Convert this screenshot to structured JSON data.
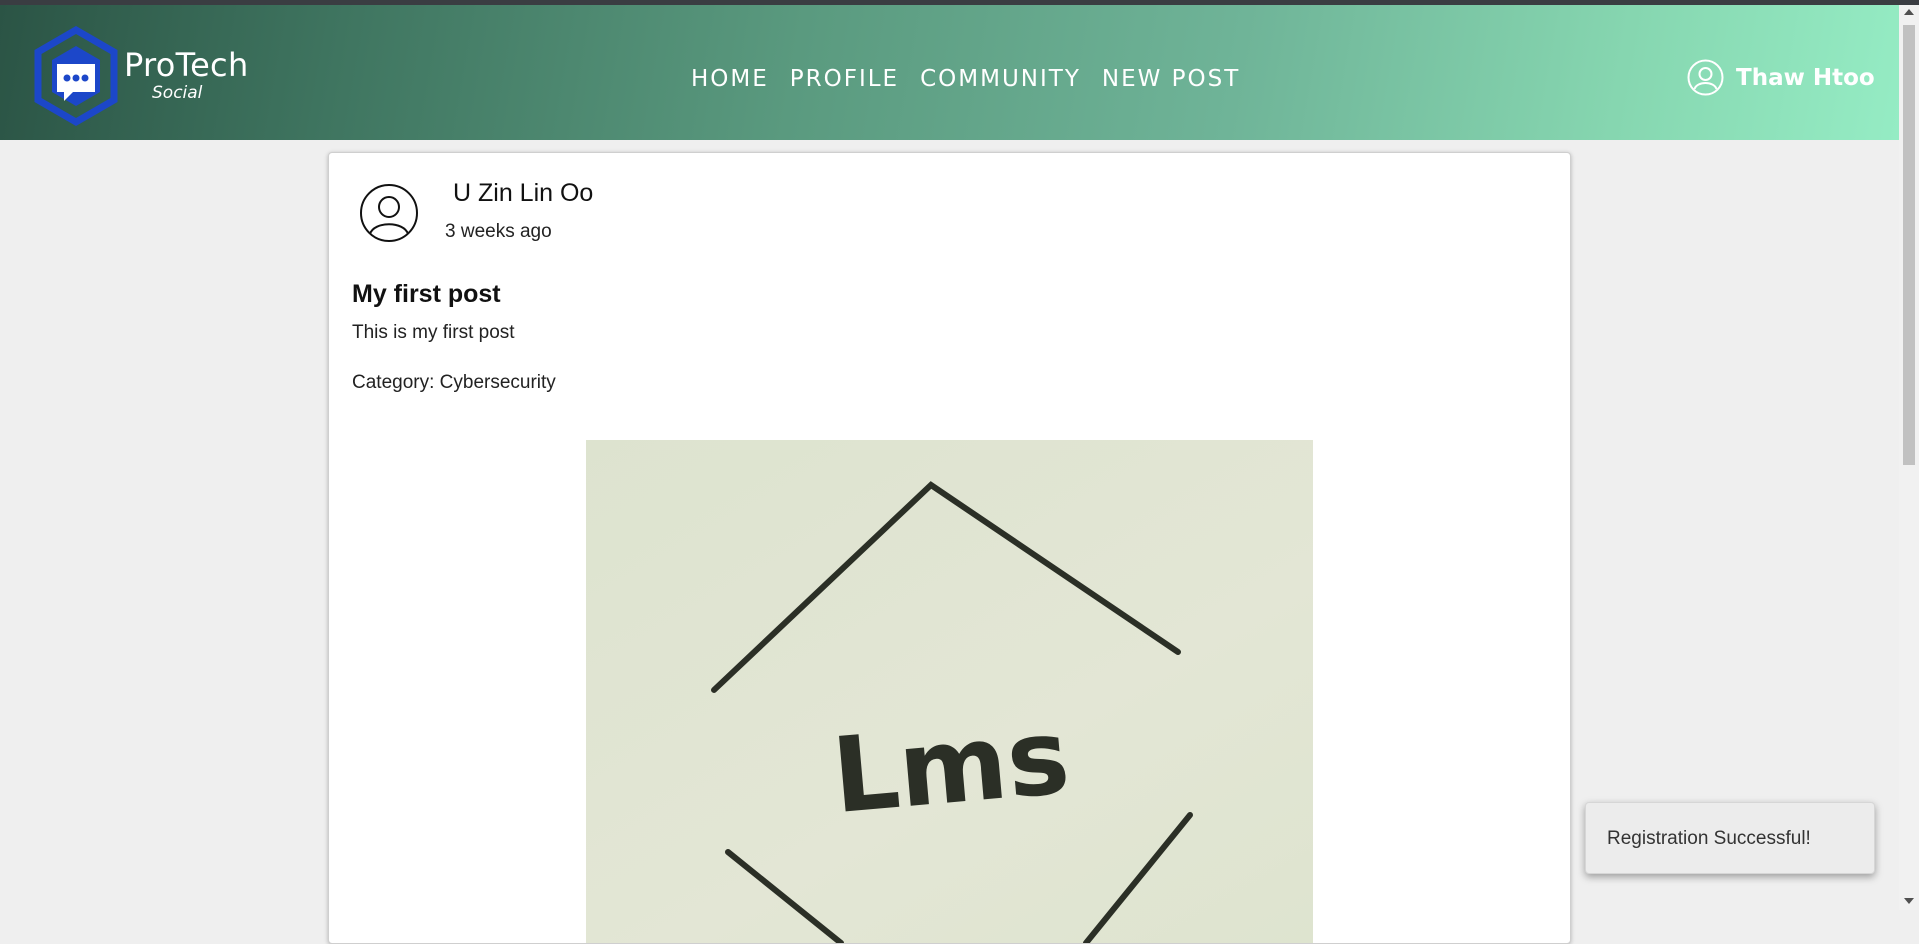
{
  "header": {
    "brand_main": "ProTech",
    "brand_sub": "Social",
    "nav": [
      {
        "label": "HOME"
      },
      {
        "label": "PROFILE"
      },
      {
        "label": "COMMUNITY"
      },
      {
        "label": "NEW POST"
      }
    ],
    "user": {
      "name": "Thaw Htoo",
      "icon": "user-circle-icon"
    }
  },
  "post": {
    "author": "U Zin Lin Oo",
    "time": "3 weeks ago",
    "title": "My first post",
    "body": "This is my first post",
    "category": "Category: Cybersecurity",
    "image_text": "Lms"
  },
  "toast": {
    "message": "Registration Successful!"
  },
  "colors": {
    "nav_gradient_start": "#2b5445",
    "nav_gradient_end": "#95ecc4",
    "logo_blue": "#1c47c9",
    "page_bg": "#efefef",
    "image_bg": "#e0e5d2",
    "image_ink": "#2b2f26"
  }
}
